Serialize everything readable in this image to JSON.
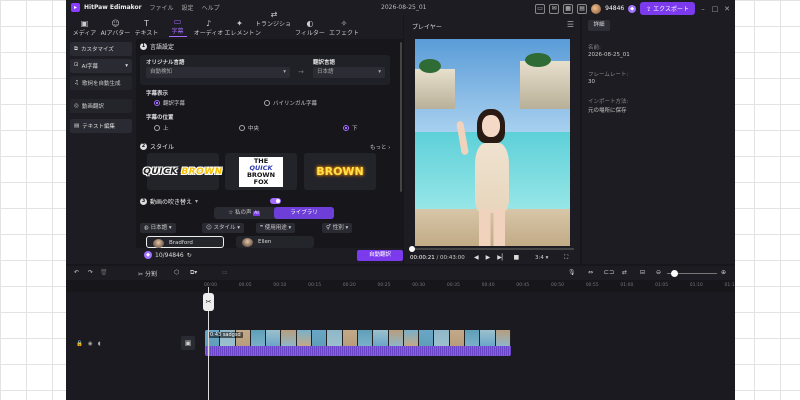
{
  "titlebar": {
    "app_name": "HitPaw Edimakor",
    "menus": [
      "ファイル",
      "設定",
      "ヘルプ"
    ],
    "project_title": "2026-08-25_01",
    "points": "94846",
    "export_label": "エクスポート"
  },
  "toolbar": {
    "tools": [
      {
        "label": "メディア",
        "icon": "media-icon"
      },
      {
        "label": "AIアバター",
        "icon": "avatar-icon"
      },
      {
        "label": "テキスト",
        "icon": "text-icon"
      },
      {
        "label": "字幕",
        "icon": "subtitle-icon"
      },
      {
        "label": "オーディオ",
        "icon": "audio-icon"
      },
      {
        "label": "エレメント",
        "icon": "element-icon"
      },
      {
        "label": "トランジション",
        "icon": "transition-icon"
      },
      {
        "label": "フィルター",
        "icon": "filter-icon"
      },
      {
        "label": "エフェクト",
        "icon": "effect-icon"
      }
    ],
    "active_index": 3
  },
  "sidebar": {
    "items": [
      "カスタマイズ",
      "AI字幕",
      "歌詞を自動生成",
      "動画翻訳",
      "テキスト編集"
    ],
    "selected_index": 3
  },
  "language": {
    "section_num": "1",
    "section_title": "言語設定",
    "original_label": "オリジナル言語",
    "original_value": "自動検知",
    "translate_label": "翻訳言語",
    "translate_value": "日本語"
  },
  "display": {
    "title": "字幕表示",
    "options": [
      "翻訳字幕",
      "バイリンガル字幕"
    ],
    "selected_index": 0
  },
  "position": {
    "title": "字幕の位置",
    "options": [
      "上",
      "中央",
      "下"
    ],
    "selected_index": 2
  },
  "style": {
    "section_num": "2",
    "section_title": "スタイル",
    "more_label": "もっと",
    "cards": [
      {
        "word1": "QUICK",
        "word2": "BROWN"
      },
      {
        "line1a": "THE",
        "line1b": "QUICK",
        "line2": "BROWN FOX"
      },
      {
        "text": "BROWN"
      }
    ]
  },
  "dub": {
    "section_num": "3",
    "section_title": "動画の吹き替え",
    "toggle_on": true,
    "tabs": [
      "私の声",
      "ライブラリ"
    ],
    "tab_badge": "AI",
    "active_tab": 1,
    "filters": [
      "日本語",
      "スタイル",
      "使用用途",
      "性別"
    ],
    "voices": [
      "Bradford",
      "Ellen"
    ],
    "selected_voice": 0
  },
  "bottom": {
    "cost": "10/94846",
    "auto_translate_label": "自動翻訳"
  },
  "player": {
    "title": "プレイヤー",
    "current_time": "00:00:21",
    "total_time": "/ 00:43:00",
    "ratio": "3:4",
    "progress": 0.01
  },
  "details": {
    "tab_label": "詳細",
    "fields": [
      {
        "label": "名前:",
        "value": "2026-08-25_01"
      },
      {
        "label": "フレームレート:",
        "value": "30"
      },
      {
        "label": "インポート方法:",
        "value": "元の場所に保存"
      }
    ]
  },
  "timeline": {
    "split_label": "分割",
    "ruler": [
      "00:00",
      "00:05",
      "00:10",
      "00:15",
      "00:20",
      "00:25",
      "00:30",
      "00:35",
      "00:40",
      "00:45",
      "00:50",
      "00:55",
      "01:00",
      "01:05",
      "01:10",
      "01:15",
      "01:20"
    ],
    "clip_label": "0:43 sadgsd"
  },
  "colors": {
    "accent": "#7c3aed",
    "highlight": "#a56bff",
    "selection_outline": "#e0504a"
  }
}
